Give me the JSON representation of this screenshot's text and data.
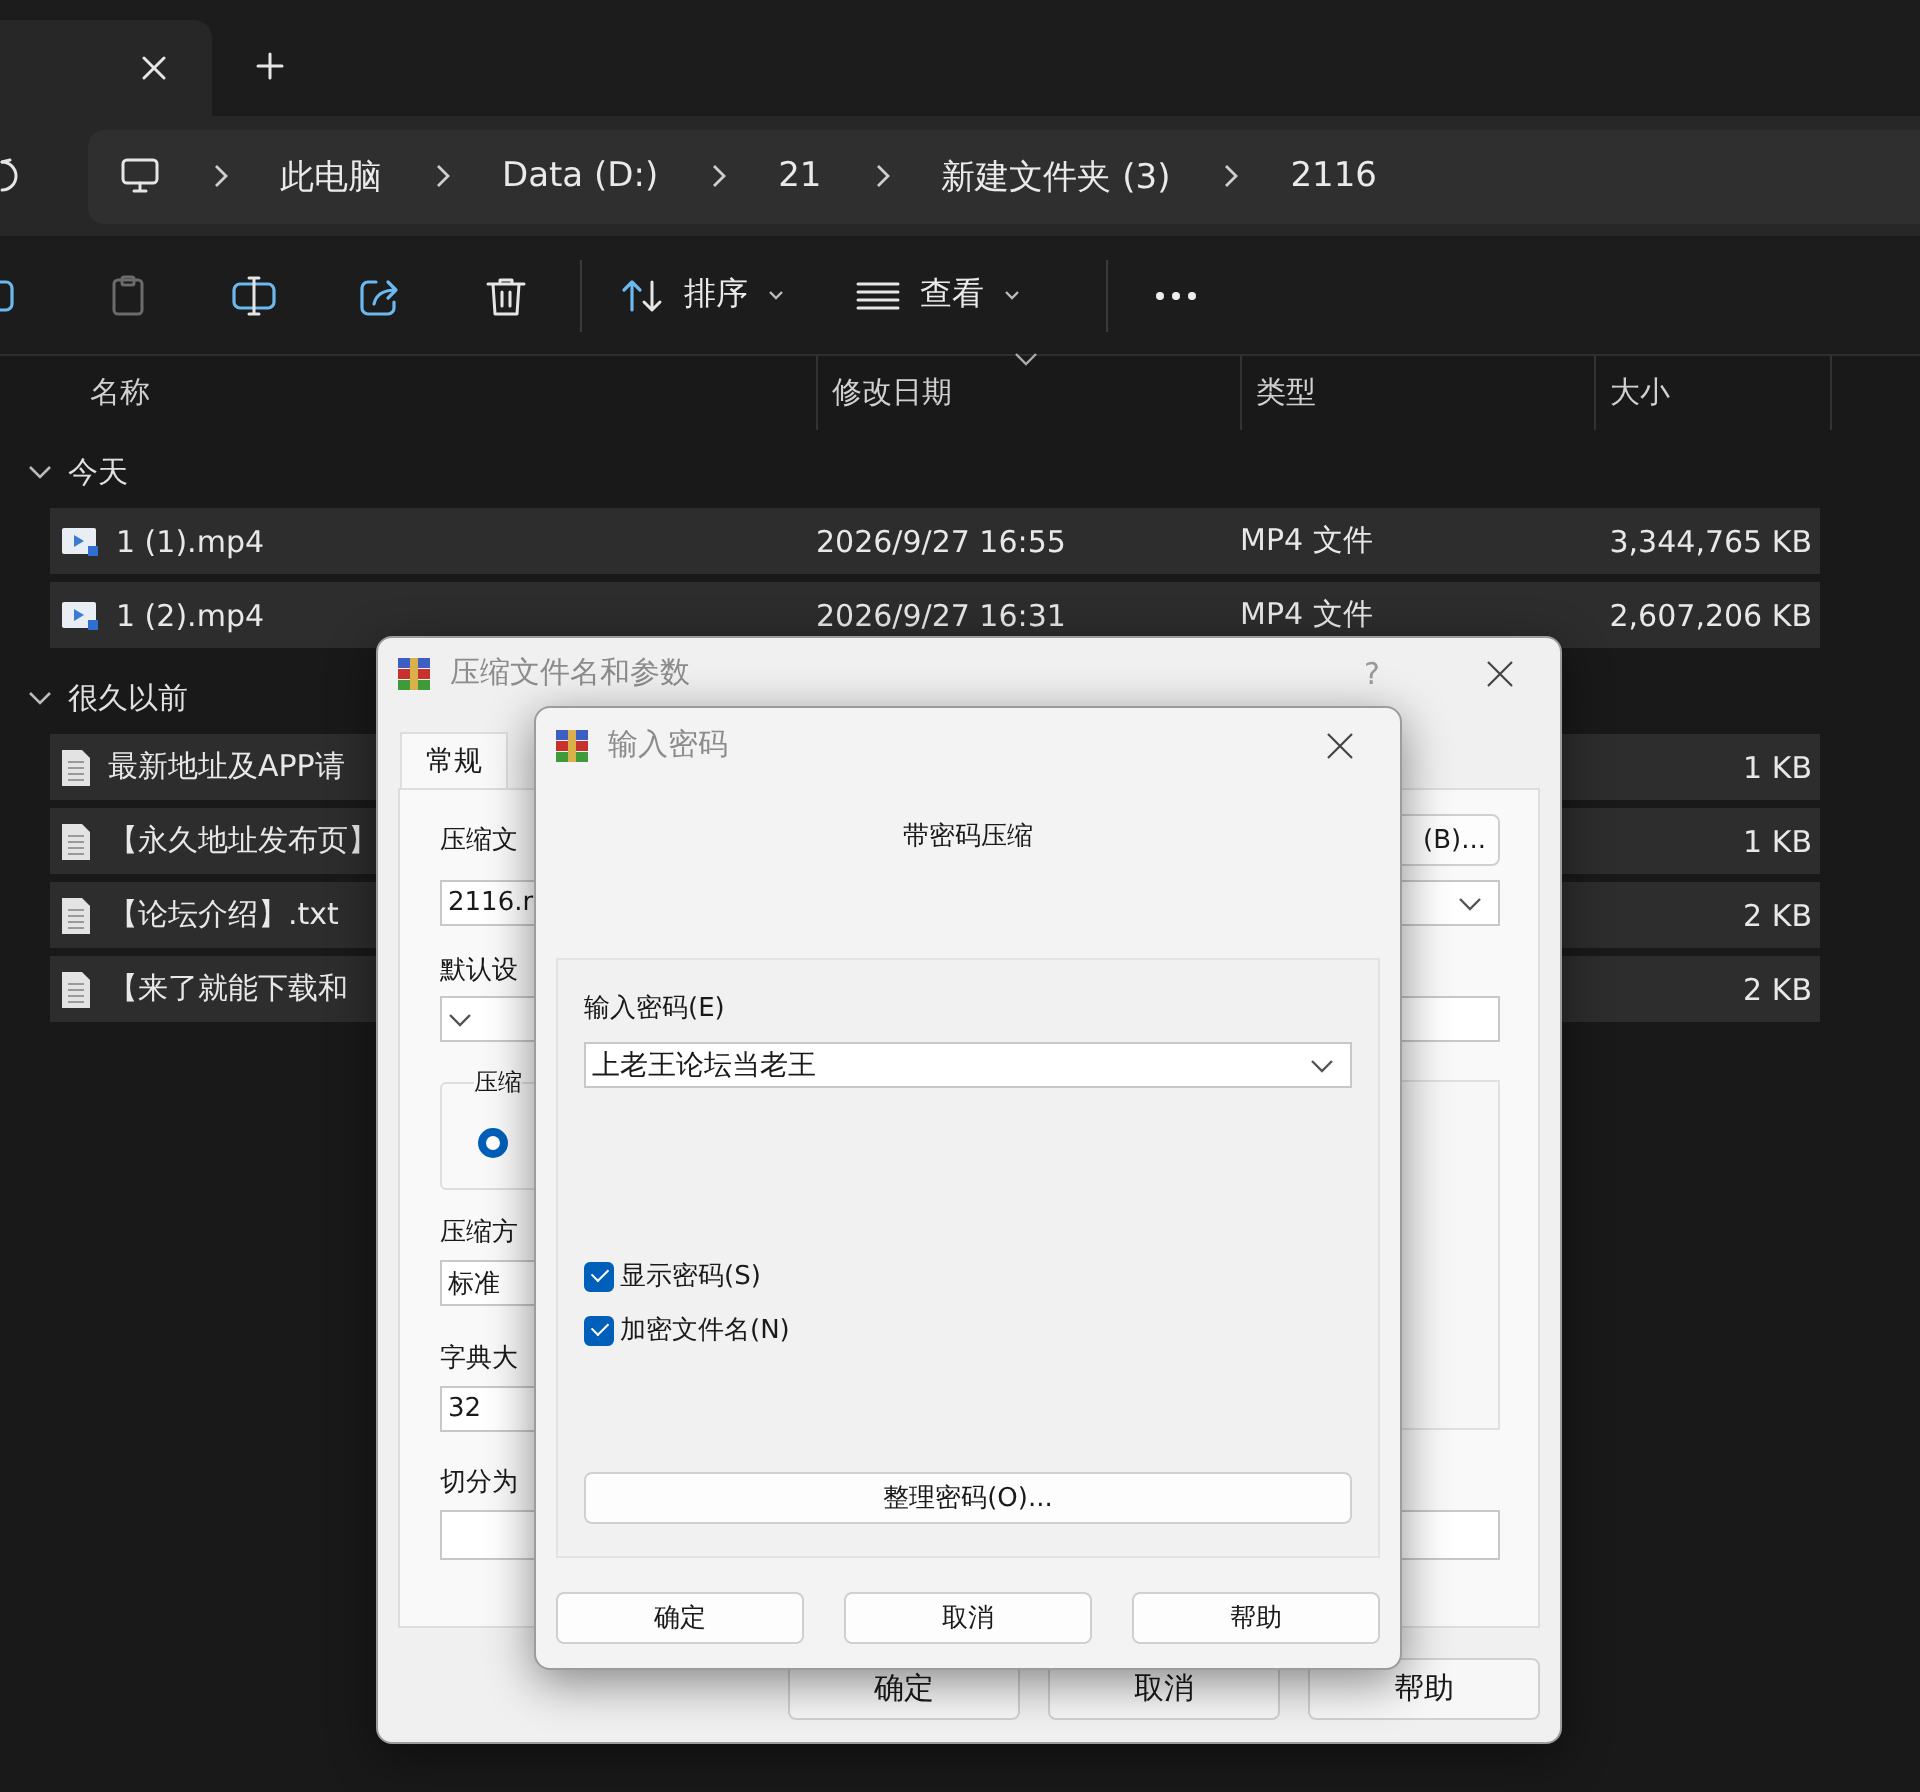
{
  "explorer": {
    "breadcrumb": [
      {
        "label": "此电脑"
      },
      {
        "label": "Data (D:)"
      },
      {
        "label": "21"
      },
      {
        "label": "新建文件夹 (3)"
      },
      {
        "label": "2116"
      }
    ],
    "toolbar": {
      "sort_label": "排序",
      "view_label": "查看"
    },
    "columns": [
      {
        "label": "名称",
        "sorted": false
      },
      {
        "label": "修改日期",
        "sorted": true
      },
      {
        "label": "类型",
        "sorted": false
      },
      {
        "label": "大小",
        "sorted": false
      }
    ],
    "groups": [
      {
        "label": "今天",
        "expanded": true,
        "rows": [
          {
            "kind": "video",
            "name": "1 (1).mp4",
            "date": "2026/9/27 16:55",
            "type": "MP4 文件",
            "size": "3,344,765 KB",
            "selected": true
          },
          {
            "kind": "video",
            "name": "1 (2).mp4",
            "date": "2026/9/27 16:31",
            "type": "MP4 文件",
            "size": "2,607,206 KB",
            "selected": true
          }
        ]
      },
      {
        "label": "很久以前",
        "expanded": true,
        "rows": [
          {
            "kind": "text",
            "name": "最新地址及APP请",
            "size": "1 KB",
            "selected": true
          },
          {
            "kind": "text",
            "name": "【永久地址发布页】",
            "size": "1 KB",
            "selected": true
          },
          {
            "kind": "text",
            "name": "【论坛介绍】.txt",
            "size": "2 KB",
            "selected": true
          },
          {
            "kind": "text",
            "name": "【来了就能下载和",
            "size": "2 KB",
            "selected": true
          }
        ]
      }
    ]
  },
  "archive_dialog": {
    "title": "压缩文件名和参数",
    "help": "?",
    "tabs": [
      {
        "label": "常规",
        "selected": true
      }
    ],
    "name_label": "压缩文",
    "browse_button": "(B)...",
    "name_value": "2116.r",
    "profile_label": "默认设",
    "format": {
      "label": "压缩",
      "radio_selected": true
    },
    "method": {
      "label": "压缩方",
      "value": "标准"
    },
    "dictionary": {
      "label": "字典大",
      "value": "32"
    },
    "split_label": "切分为",
    "buttons": [
      {
        "label": "确定"
      },
      {
        "label": "取消"
      },
      {
        "label": "帮助"
      }
    ]
  },
  "password_dialog": {
    "title": "输入密码",
    "heading": "带密码压缩",
    "password_label": "输入密码(E)",
    "password_value": "上老王论坛当老王",
    "options": [
      {
        "label": "显示密码(S)",
        "checked": true
      },
      {
        "label": "加密文件名(N)",
        "checked": true
      }
    ],
    "organize_button": "整理密码(O)...",
    "buttons": [
      {
        "label": "确定"
      },
      {
        "label": "取消"
      },
      {
        "label": "帮助"
      }
    ]
  }
}
